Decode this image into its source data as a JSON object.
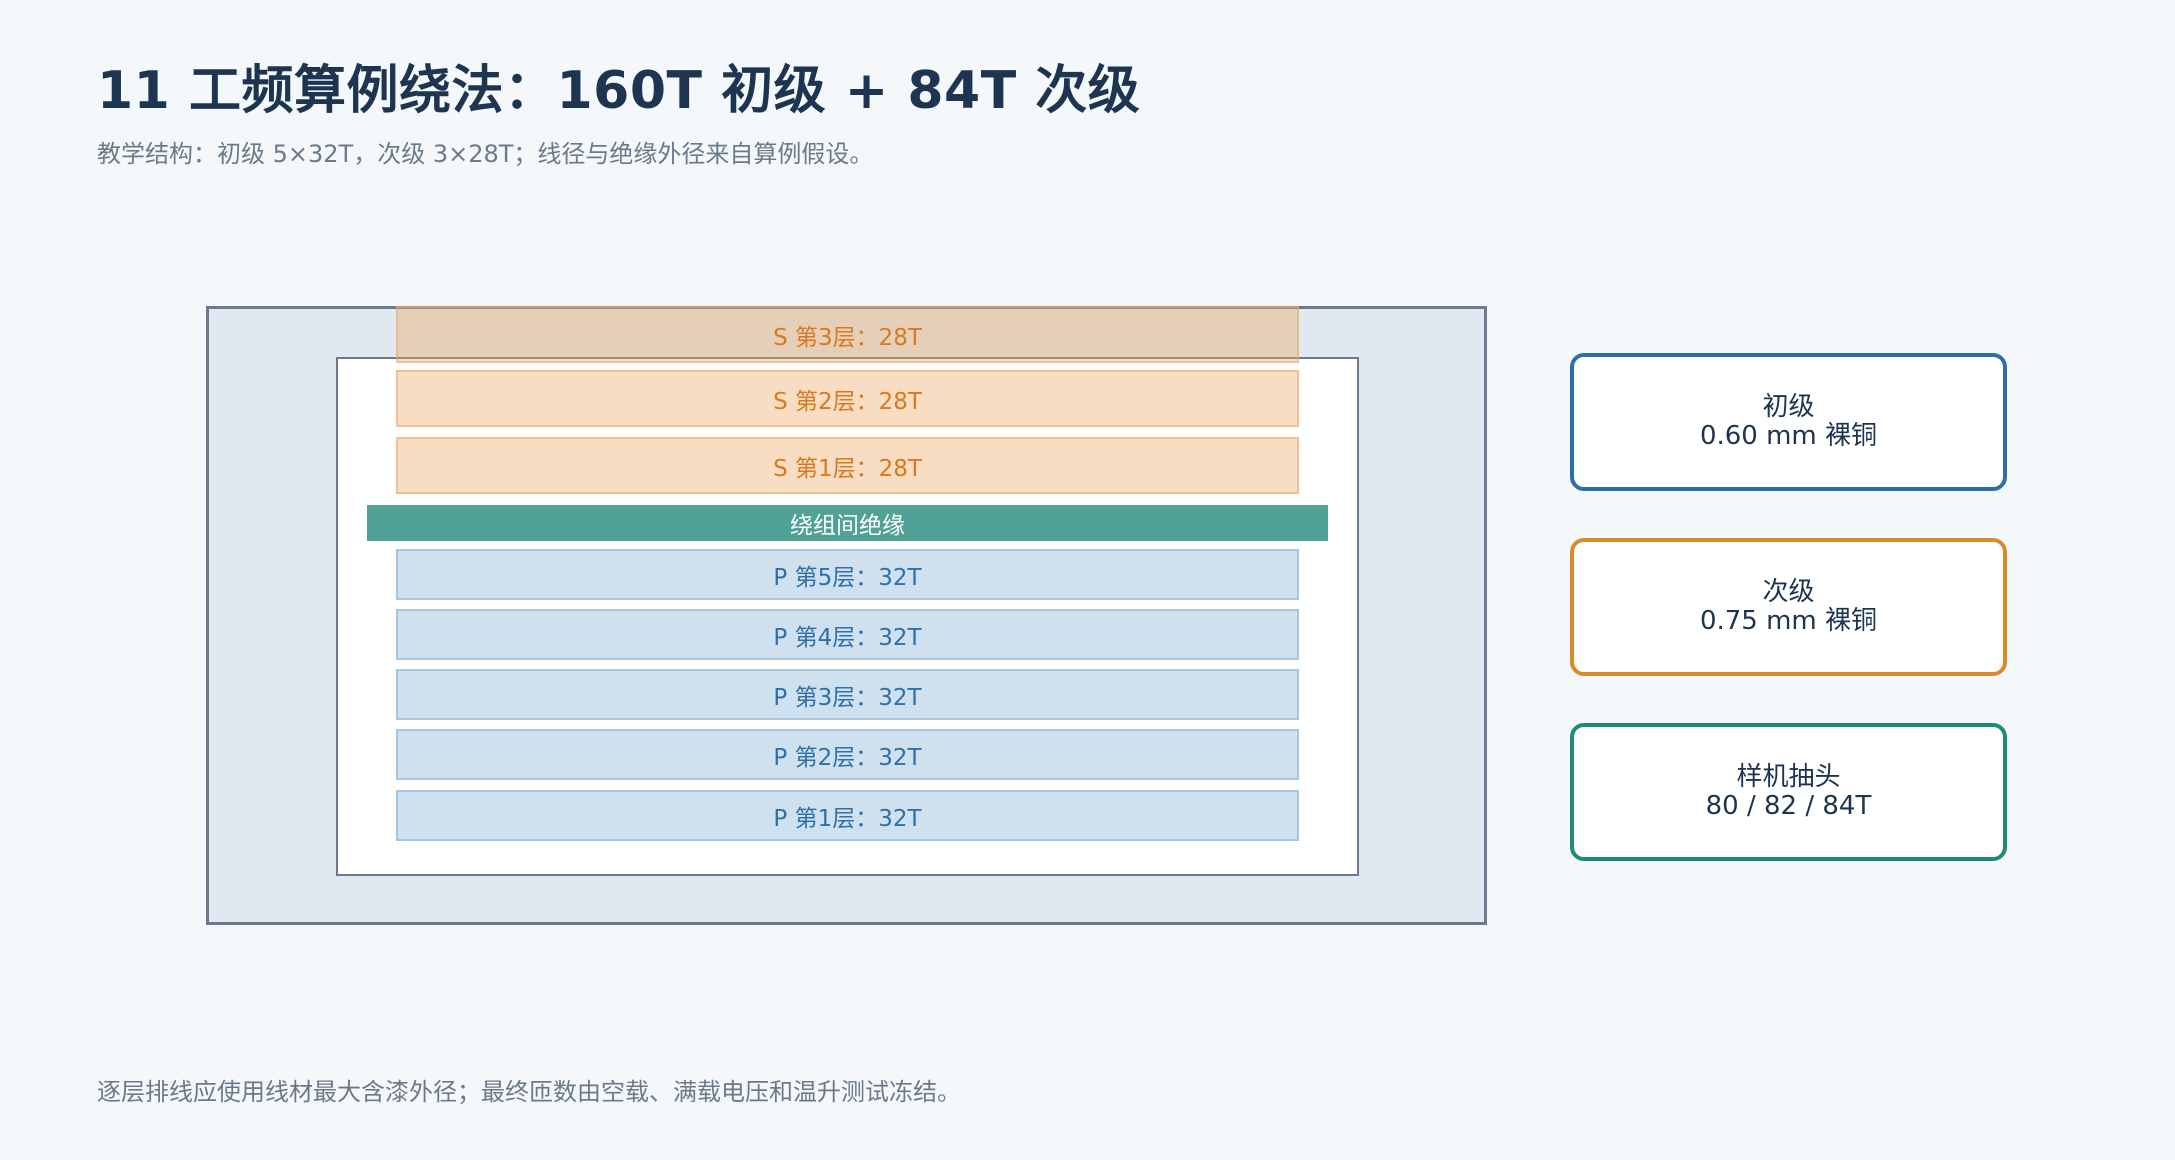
{
  "title": "11  工频算例绕法：160T 初级 + 84T 次级",
  "subtitle": "教学结构：初级 5×32T，次级 3×28T；线径与绝缘外径来自算例假设。",
  "footer": "逐层排线应使用线材最大含漆外径；最终匝数由空载、满载电压和温升测试冻结。",
  "diagram": {
    "secondary_layers": [
      {
        "label": "S 第3层：28T",
        "turns": 28
      },
      {
        "label": "S 第2层：28T",
        "turns": 28
      },
      {
        "label": "S 第1层：28T",
        "turns": 28
      }
    ],
    "insulation_label": "绕组间绝缘",
    "primary_layers": [
      {
        "label": "P 第5层：32T",
        "turns": 32
      },
      {
        "label": "P 第4层：32T",
        "turns": 32
      },
      {
        "label": "P 第3层：32T",
        "turns": 32
      },
      {
        "label": "P 第2层：32T",
        "turns": 32
      },
      {
        "label": "P 第1层：32T",
        "turns": 32
      }
    ]
  },
  "cards": [
    {
      "line1": "初级",
      "line2": "0.60 mm 裸铜",
      "color": "#2c6ea8"
    },
    {
      "line1": "次级",
      "line2": "0.75 mm 裸铜",
      "color": "#d98a2c"
    },
    {
      "line1": "样机抽头",
      "line2": "80 / 82 / 84T",
      "color": "#1f8a7a"
    }
  ],
  "colors": {
    "secondary_text": "#d77a1f",
    "primary_text": "#2f70a8",
    "insulation": "#52a196",
    "frame": "#6b7a8e"
  }
}
